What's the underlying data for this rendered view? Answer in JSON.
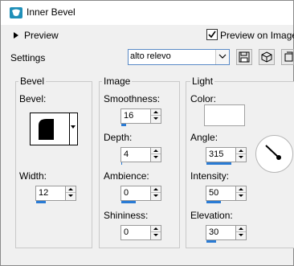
{
  "window": {
    "title": "Inner Bevel"
  },
  "preview": {
    "label": "Preview",
    "checkbox_label": "Preview on Image",
    "checked": true
  },
  "settings": {
    "label": "Settings",
    "preset": "alto relevo"
  },
  "bevel": {
    "title": "Bevel",
    "bevel_label": "Bevel:",
    "width_label": "Width:",
    "width": "12",
    "width_fill": 0.35
  },
  "image": {
    "title": "Image",
    "smoothness_label": "Smoothness:",
    "smoothness": "16",
    "smoothness_fill": 0.16,
    "depth_label": "Depth:",
    "depth": "4",
    "depth_fill": 0.04,
    "ambience_label": "Ambience:",
    "ambience": "0",
    "ambience_fill": 0.5,
    "shininess_label": "Shininess:",
    "shininess": "0",
    "shininess_fill": 0.0
  },
  "light": {
    "title": "Light",
    "color_label": "Color:",
    "color": "#ffffff",
    "angle_label": "Angle:",
    "angle": "315",
    "angle_fill": 0.875,
    "intensity_label": "Intensity:",
    "intensity": "50",
    "intensity_fill": 0.5,
    "elevation_label": "Elevation:",
    "elevation": "30",
    "elevation_fill": 0.33
  },
  "colors": {
    "accent": "#2a7bd4",
    "icon_teal": "#1f8fb8"
  }
}
